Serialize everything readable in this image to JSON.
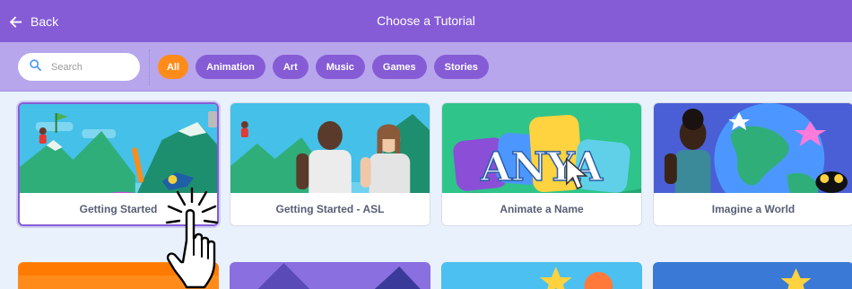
{
  "header": {
    "back_label": "Back",
    "title": "Choose a Tutorial"
  },
  "search": {
    "placeholder": "Search"
  },
  "filters": [
    {
      "label": "All",
      "active": true
    },
    {
      "label": "Animation",
      "active": false
    },
    {
      "label": "Art",
      "active": false
    },
    {
      "label": "Music",
      "active": false
    },
    {
      "label": "Games",
      "active": false
    },
    {
      "label": "Stories",
      "active": false
    }
  ],
  "cards": [
    {
      "label": "Getting Started",
      "selected": true
    },
    {
      "label": "Getting Started - ASL",
      "selected": false
    },
    {
      "label": "Animate a Name",
      "selected": false
    },
    {
      "label": "Imagine a World",
      "selected": false
    }
  ],
  "thumb_text": {
    "anya": "ANYA"
  },
  "colors": {
    "header": "#855cd6",
    "filter_bar": "#b7a6ec",
    "chip": "#855cd6",
    "chip_active": "#ff8c1a",
    "page_bg": "#e9f1fc",
    "label_text": "#575e75"
  },
  "icons": {
    "back": "arrow-left-icon",
    "search": "search-icon",
    "pointer": "pointing-hand-icon"
  }
}
